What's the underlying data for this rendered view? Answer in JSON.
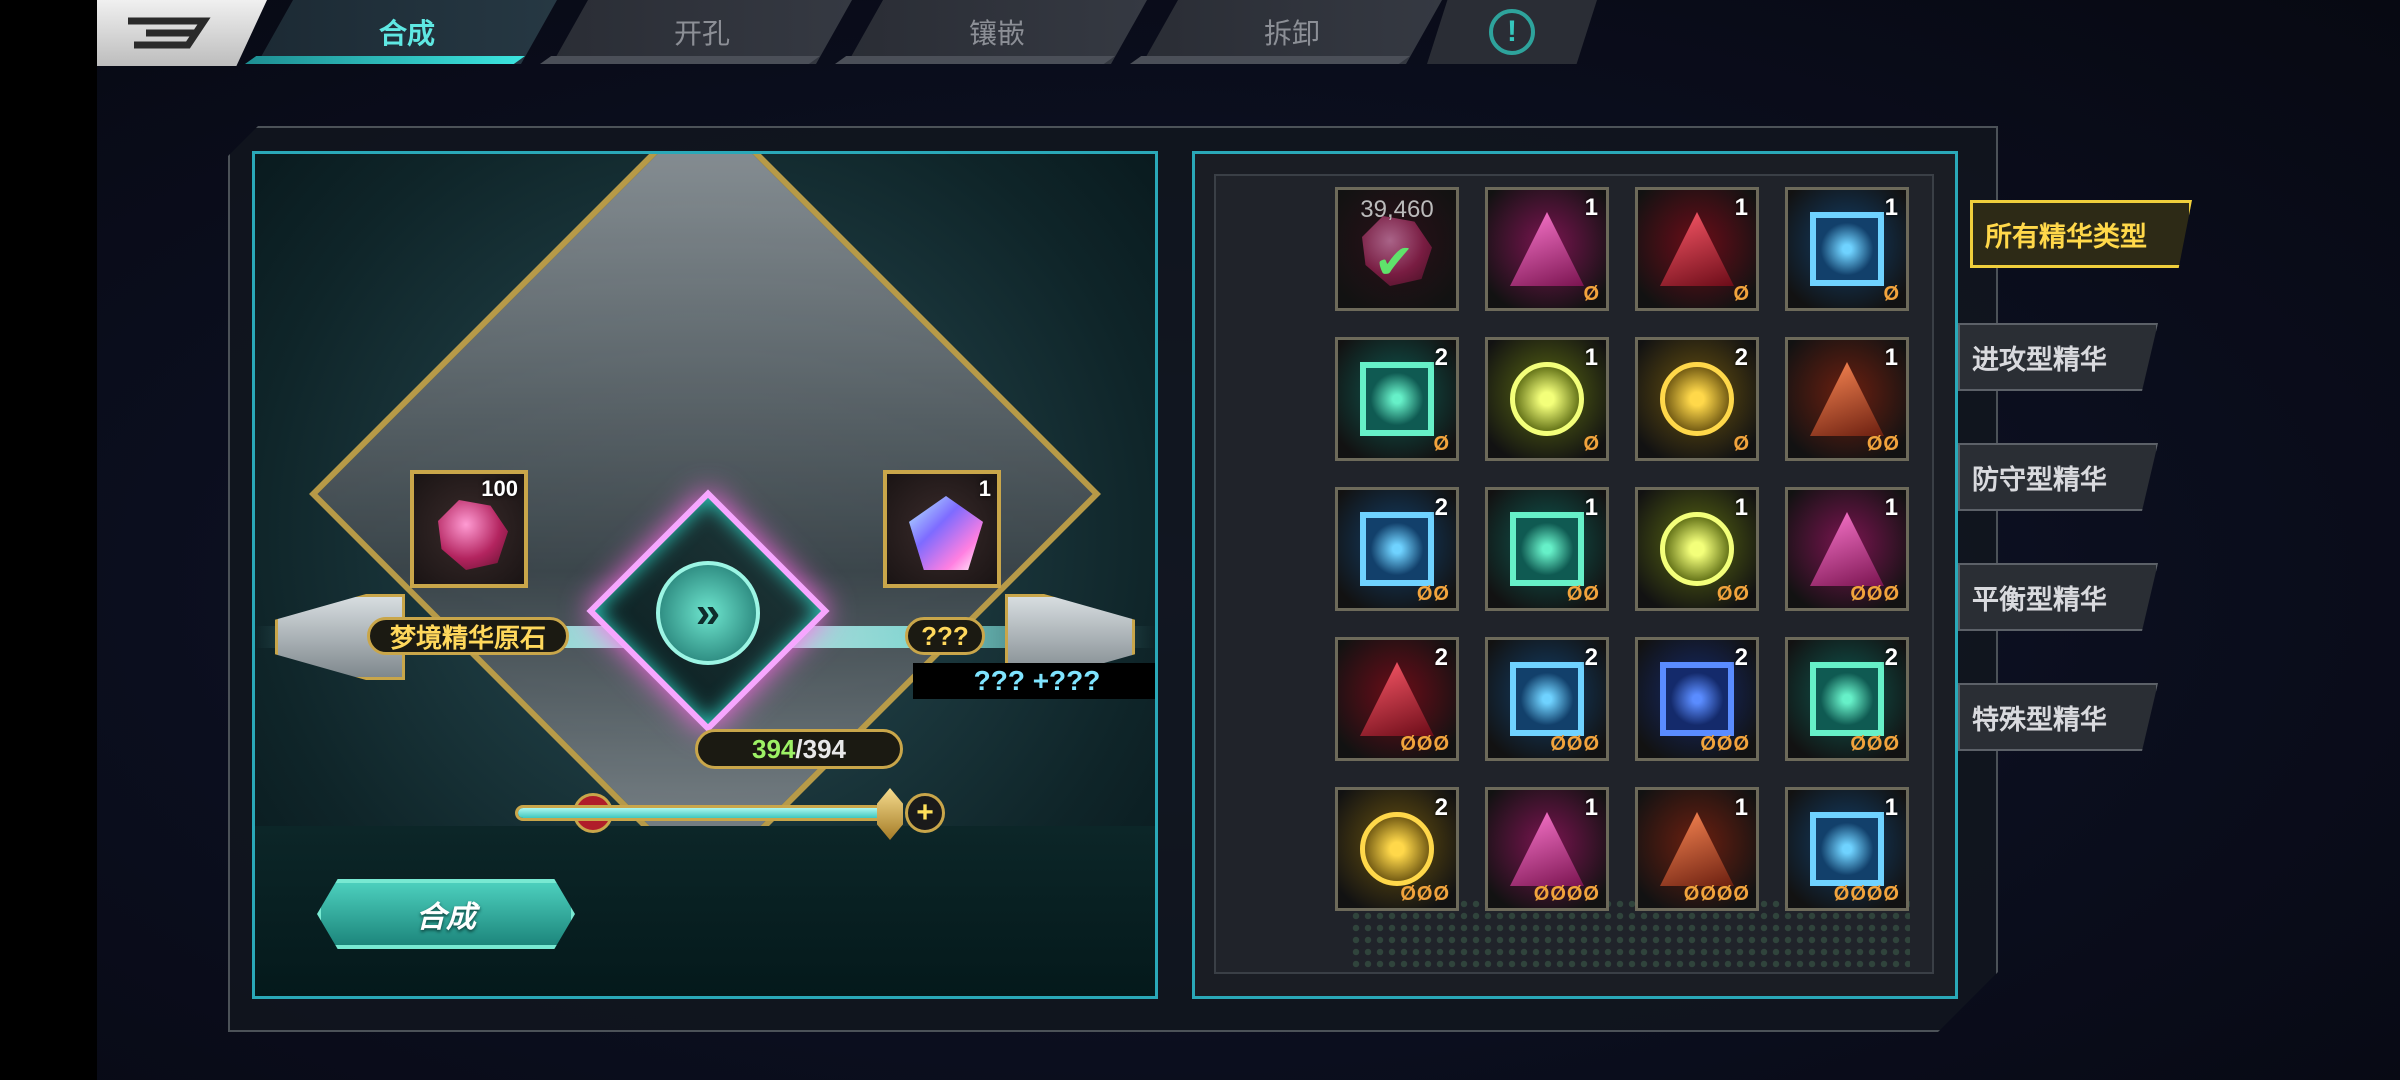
{
  "tabs": [
    {
      "label": "合成",
      "active": true
    },
    {
      "label": "开孔",
      "active": false
    },
    {
      "label": "镶嵌",
      "active": false
    },
    {
      "label": "拆卸",
      "active": false
    }
  ],
  "info_icon": "!",
  "synthesis": {
    "material": {
      "name": "梦境精华原石",
      "count": "100"
    },
    "result": {
      "name": "???",
      "count": "1",
      "stat": "??? +???"
    },
    "counter": {
      "current": "394",
      "separator": "/",
      "max": "394"
    },
    "slider_level": 1.0,
    "minus_glyph": "−",
    "plus_glyph": "+",
    "center_glyph": "»",
    "button_label": "合成"
  },
  "inventory": {
    "items": [
      {
        "type": "ore",
        "stock": "39,460",
        "selected": true,
        "count": "",
        "slots": ""
      },
      {
        "type": "tri-pink",
        "count": "1",
        "slots": "Ø"
      },
      {
        "type": "tri-red",
        "count": "1",
        "slots": "Ø"
      },
      {
        "type": "sq-blue",
        "count": "1",
        "slots": "Ø"
      },
      {
        "type": "sq-teal",
        "count": "2",
        "slots": "Ø"
      },
      {
        "type": "circ-yellow",
        "count": "1",
        "slots": "Ø"
      },
      {
        "type": "circ-gold",
        "count": "2",
        "slots": "Ø"
      },
      {
        "type": "tri-orange",
        "count": "1",
        "slots": "ØØ"
      },
      {
        "type": "sq-blue",
        "count": "2",
        "slots": "ØØ"
      },
      {
        "type": "sq-teal",
        "count": "1",
        "slots": "ØØ"
      },
      {
        "type": "circ-yellow",
        "count": "1",
        "slots": "ØØ"
      },
      {
        "type": "tri-pink",
        "count": "1",
        "slots": "ØØØ"
      },
      {
        "type": "tri-red",
        "count": "2",
        "slots": "ØØØ"
      },
      {
        "type": "sq-blue",
        "count": "2",
        "slots": "ØØØ"
      },
      {
        "type": "sq-navy",
        "count": "2",
        "slots": "ØØØ"
      },
      {
        "type": "sq-teal",
        "count": "2",
        "slots": "ØØØ"
      },
      {
        "type": "circ-gold",
        "count": "2",
        "slots": "ØØØ"
      },
      {
        "type": "tri-pink",
        "count": "1",
        "slots": "ØØØØ"
      },
      {
        "type": "tri-orange",
        "count": "1",
        "slots": "ØØØØ"
      },
      {
        "type": "sq-blue",
        "count": "1",
        "slots": "ØØØØ"
      }
    ]
  },
  "categories": [
    {
      "label": "所有精华类型",
      "active": true
    },
    {
      "label": "进攻型精华",
      "active": false
    },
    {
      "label": "防守型精华",
      "active": false
    },
    {
      "label": "平衡型精华",
      "active": false
    },
    {
      "label": "特殊型精华",
      "active": false
    }
  ],
  "colors": {
    "accent": "#3ce6e0",
    "gold": "#c9a64a",
    "selected": "#f0cf3c",
    "counter_current": "#9df265",
    "slot_orange": "#f1a33c"
  },
  "gem_colors": {
    "tri-pink": [
      "#ff7ad1",
      "#7a1450"
    ],
    "tri-red": [
      "#ff5a6a",
      "#6b0c18"
    ],
    "tri-orange": [
      "#ff8a55",
      "#6b1f10"
    ],
    "sq-blue": [
      "#6fd2ff",
      "#12406b"
    ],
    "sq-navy": [
      "#5a8cff",
      "#142a6b"
    ],
    "sq-teal": [
      "#66f0c8",
      "#0f5a52"
    ],
    "circ-yellow": [
      "#f3ff7a",
      "#5c6b12"
    ],
    "circ-gold": [
      "#ffd84a",
      "#6b5410"
    ],
    "ore": [
      "#b3245f",
      "#2a1018"
    ]
  }
}
